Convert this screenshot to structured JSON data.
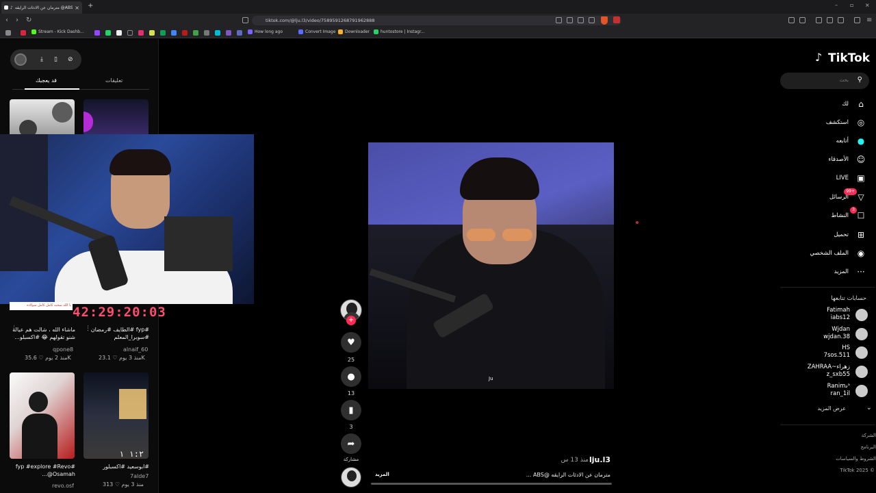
{
  "browser": {
    "tab_title": "مترمان عن الادثات الرايقه @ABS...",
    "new_tab": "+",
    "url": "tiktok.com/@lju.l3/video/7589591268791962888",
    "bookmarks": [
      {
        "label": "Stream - Kick Dashb...",
        "color": "#53fc18"
      },
      {
        "label": "How long ago",
        "color": "#7b61ff"
      },
      {
        "label": "Convert Image",
        "color": "#5a6cff"
      },
      {
        "label": "Downloader",
        "color": "#f7b32b"
      },
      {
        "label": "huntostore | Instagr...",
        "color": "#25d366"
      }
    ]
  },
  "left": {
    "tabs": {
      "comments": "تعليقات",
      "for_you": "قد يعجبك"
    },
    "cards": [
      {
        "caption": "ماشاء الله ، شالت هم عيالة شنو تقولهم 😂 #اكسبلو...",
        "user": "qpone8",
        "views": "35.6K",
        "age": "منذ 2 يوم"
      },
      {
        "caption": "#fyp #الطايف #رمضان #سوبرا_المعلم",
        "user": "alnaif_60",
        "views": "23.1K",
        "age": "منذ 3 يوم"
      },
      {
        "caption": "#fyp #explore #Revo @Osamah...",
        "user": "revo.osf",
        "views": "",
        "age": ""
      },
      {
        "caption": "#ابوسعيد #اكسبلور",
        "user": "7alde7",
        "views": "313",
        "age": "منذ 3 يوم"
      }
    ],
    "pip_label": "يا الله سحبه كامل كامل سولاده",
    "timer": "42:29:20:03"
  },
  "video": {
    "caption_overlay": "Ju",
    "likes": "25",
    "comments": "13",
    "saves": "3",
    "share_label": "مشاركة",
    "username": "lju.l3",
    "posted": "منذ 13 س",
    "description": "مترمان عن الادثات الرايقه @ABS ...",
    "more": "المزيد"
  },
  "right": {
    "logo": "TikTok",
    "search_placeholder": "بحث",
    "nav": [
      {
        "label": "لك",
        "icon": "⌂"
      },
      {
        "label": "استكشف",
        "icon": "◎"
      },
      {
        "label": "أتابعه",
        "icon": "●"
      },
      {
        "label": "الأصدقاء",
        "icon": "☺"
      },
      {
        "label": "LIVE",
        "icon": "▣"
      },
      {
        "label": "الرسائل",
        "icon": "▽",
        "badge": "99+"
      },
      {
        "label": "النشاط",
        "icon": "☐",
        "badge": "3"
      },
      {
        "label": "تحميل",
        "icon": "⊞"
      },
      {
        "label": "الملف الشخصي",
        "icon": "◉"
      },
      {
        "label": "المزيد",
        "icon": "···"
      }
    ],
    "following_title": "حسابات تتابعها",
    "following": [
      {
        "name": "Fatimah",
        "handle": "iabs12"
      },
      {
        "name": "Wjdan",
        "handle": "wjdan.38"
      },
      {
        "name": "HS",
        "handle": "7sos.511"
      },
      {
        "name": "ZAHRAA~زهراء",
        "handle": "z_sxb55"
      },
      {
        "name": "Ranim𝓈ᵃ",
        "handle": "ran_1il"
      }
    ],
    "see_more": "عرض المزيد",
    "footer": [
      "الشركة",
      "البرنامج",
      "الشروط والسياسات",
      "TikTok 2025 ©"
    ]
  }
}
